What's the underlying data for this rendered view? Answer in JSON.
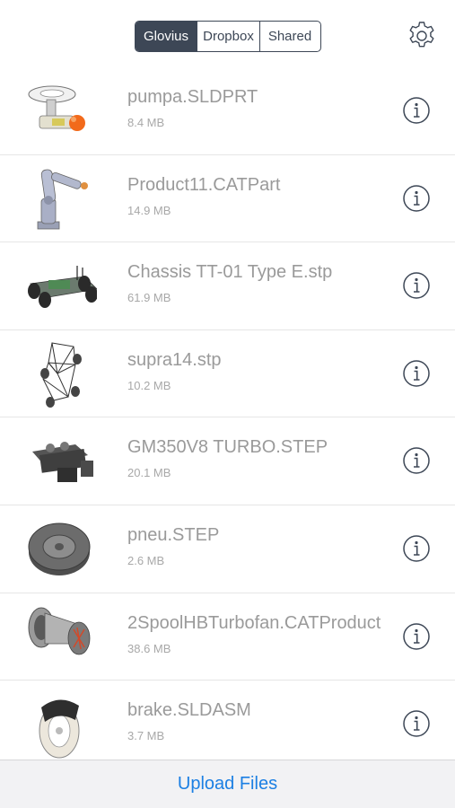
{
  "segments": [
    "Glovius",
    "Dropbox",
    "Shared"
  ],
  "active_segment": "Glovius",
  "settings_icon": "gear-icon",
  "info_icon": "info-circle-icon",
  "files": [
    {
      "name": "pumpa.SLDPRT",
      "size": "8.4 MB",
      "thumbnail": "pump-model-thumbnail"
    },
    {
      "name": "Product11.CATPart",
      "size": "14.9 MB",
      "thumbnail": "robot-arm-thumbnail"
    },
    {
      "name": "Chassis TT-01 Type E.stp",
      "size": "61.9 MB",
      "thumbnail": "rc-chassis-thumbnail"
    },
    {
      "name": "supra14.stp",
      "size": "10.2 MB",
      "thumbnail": "space-frame-thumbnail"
    },
    {
      "name": "GM350V8 TURBO.STEP",
      "size": "20.1 MB",
      "thumbnail": "v8-engine-thumbnail"
    },
    {
      "name": "pneu.STEP",
      "size": "2.6 MB",
      "thumbnail": "tire-thumbnail"
    },
    {
      "name": "2SpoolHBTurbofan.CATProduct",
      "size": "38.6 MB",
      "thumbnail": "turbofan-thumbnail"
    },
    {
      "name": "brake.SLDASM",
      "size": "3.7 MB",
      "thumbnail": "brake-disc-thumbnail"
    }
  ],
  "bottom_action": "Upload Files",
  "colors": {
    "segment_dark": "#3d4756",
    "file_name_gray": "#9a9a9a",
    "link_blue": "#1b7fe3",
    "bottom_bar_bg": "#f2f2f4",
    "model_orange": "#f26a1b"
  }
}
